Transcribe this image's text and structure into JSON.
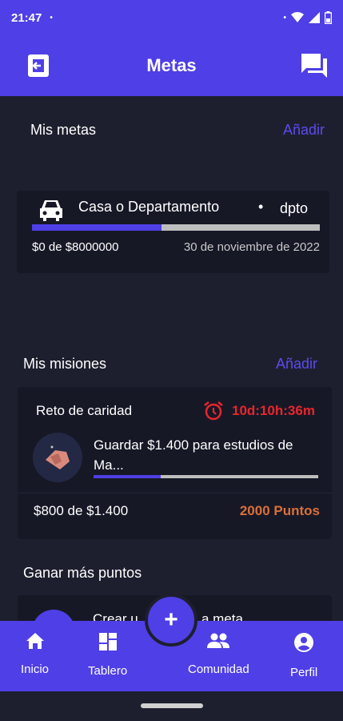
{
  "status": {
    "time": "21:47",
    "dot": "•",
    "dot2": "•"
  },
  "appbar": {
    "title": "Metas"
  },
  "goals": {
    "section_title": "Mis metas",
    "add_label": "Añadir",
    "card": {
      "name": "Casa o Departamento",
      "separator": "•",
      "tag": "dpto",
      "amount": "$0 de $8000000",
      "date": "30 de noviembre de 2022",
      "progress": 0.45
    }
  },
  "missions": {
    "section_title": "Mis misiones",
    "add_label": "Añadir",
    "card": {
      "title": "Reto de caridad",
      "timer": "10d:10h:36m",
      "description_line1": "Guardar $1.400 para estudios de",
      "description_line2": "Ma...",
      "progress": 0.3,
      "amount": "$800 de $1.400",
      "points": "2000 Puntos"
    }
  },
  "earn": {
    "section_title": "Ganar más puntos",
    "partial_item": "Crear u",
    "partial_item_2": "a meta"
  },
  "fab": {
    "label": "+"
  },
  "bottomnav": {
    "items": [
      {
        "label": "Inicio"
      },
      {
        "label": "Tablero"
      },
      {
        "label": "Comunidad"
      },
      {
        "label": "Perfil"
      }
    ]
  },
  "colors": {
    "primary": "#4f3fe6",
    "background": "#1e1f2e",
    "card": "#171826",
    "timer": "#e8262d",
    "points": "#d9703a"
  }
}
